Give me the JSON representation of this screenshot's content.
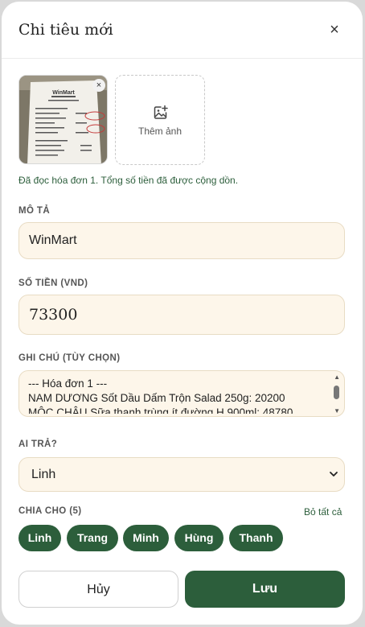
{
  "modal": {
    "title": "Chi tiêu mới",
    "close_icon": "×"
  },
  "photos": {
    "add_label": "Thêm ảnh",
    "remove_icon": "×",
    "receipt_logo": "WinMart",
    "status": "Đã đọc hóa đơn 1. Tổng số tiền đã được cộng dồn."
  },
  "description": {
    "label": "MÔ TẢ",
    "value": "WinMart"
  },
  "amount": {
    "label": "SỐ TIỀN (VND)",
    "value": "73300"
  },
  "notes": {
    "label": "GHI CHÚ (TÙY CHỌN)",
    "lines": [
      "--- Hóa đơn 1 ---",
      "NAM DƯƠNG Sốt Dầu Dấm Trộn Salad 250g: 20200",
      "MỘC CHÂU Sữa thanh trùng ít đường H 900ml: 48780"
    ]
  },
  "payer": {
    "label": "AI TRẢ?",
    "selected": "Linh"
  },
  "split": {
    "label": "CHIA CHO (5)",
    "clear_all": "Bỏ tất cả",
    "members": [
      "Linh",
      "Trang",
      "Minh",
      "Hùng",
      "Thanh"
    ]
  },
  "actions": {
    "cancel": "Hủy",
    "save": "Lưu"
  },
  "colors": {
    "accent": "#2c5e3b",
    "field_bg": "#fdf6ea",
    "field_border": "#e8dcc4"
  }
}
